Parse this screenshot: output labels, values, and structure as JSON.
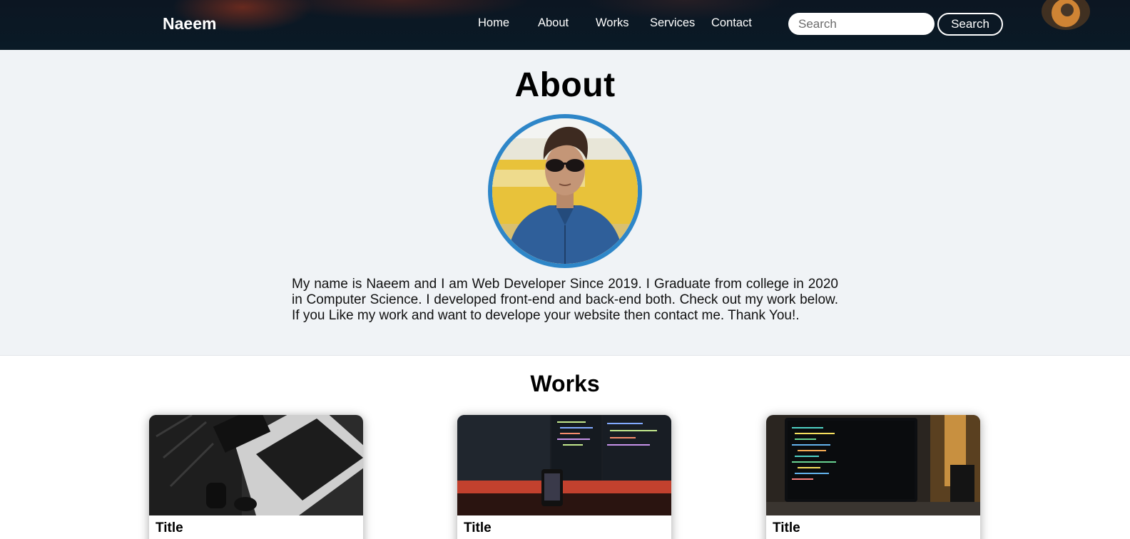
{
  "navbar": {
    "brand": "Naeem",
    "links": [
      "Home",
      "About",
      "Works",
      "Services",
      "Contact"
    ],
    "search_placeholder": "Search",
    "search_button": "Search"
  },
  "about": {
    "title": "About",
    "text": "My name is Naeem and I am Web Developer Since 2019. I Graduate from college in 2020 in Computer Science. I developed front-end and back-end both. Check out my work below. If you Like my work and want to develope your website then contact me. Thank You!."
  },
  "works": {
    "title": "Works",
    "cards": [
      {
        "title": "Title",
        "image": "laptop-keyboard-photo"
      },
      {
        "title": "Title",
        "image": "code-monitors-photo"
      },
      {
        "title": "Title",
        "image": "laptop-code-photo"
      }
    ]
  },
  "colors": {
    "navbar_bg": "#0c1622",
    "about_bg": "#f0f3f6",
    "avatar_border": "#2e86c8"
  }
}
